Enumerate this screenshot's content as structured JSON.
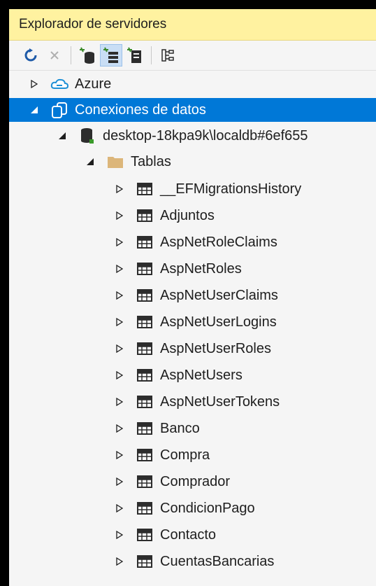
{
  "panel": {
    "title": "Explorador de servidores"
  },
  "toolbar": {
    "buttons": [
      {
        "name": "refresh-icon",
        "active": false
      },
      {
        "name": "stop-icon",
        "active": false
      },
      {
        "name": "connect-to-database-icon",
        "active": false
      },
      {
        "name": "connect-to-server-icon",
        "active": true
      },
      {
        "name": "connect-to-sharepoint-icon",
        "active": false
      },
      {
        "name": "properties-icon",
        "active": false
      }
    ]
  },
  "tree": {
    "azure": {
      "label": "Azure",
      "expanded": false
    },
    "connections": {
      "label": "Conexiones de datos",
      "expanded": true,
      "selected": true
    },
    "database": {
      "label": "desktop-18kpa9k\\localdb#6ef655",
      "expanded": true
    },
    "tables_folder": {
      "label": "Tablas",
      "expanded": true
    },
    "tables": [
      "__EFMigrationsHistory",
      "Adjuntos",
      "AspNetRoleClaims",
      "AspNetRoles",
      "AspNetUserClaims",
      "AspNetUserLogins",
      "AspNetUserRoles",
      "AspNetUsers",
      "AspNetUserTokens",
      "Banco",
      "Compra",
      "Comprador",
      "CondicionPago",
      "Contacto",
      "CuentasBancarias"
    ]
  },
  "colors": {
    "title_bg": "#fff2a0",
    "selection_bg": "#0078d7",
    "folder": "#dcb67a",
    "panel_bg": "#f5f5f5"
  }
}
